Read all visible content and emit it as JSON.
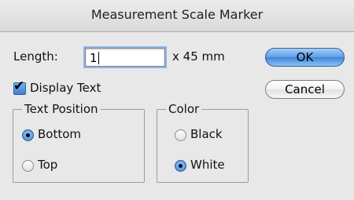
{
  "window": {
    "title": "Measurement Scale Marker"
  },
  "length": {
    "label": "Length:",
    "value": "1",
    "unit": "x 45 mm"
  },
  "display_text": {
    "label": "Display Text",
    "checked": true
  },
  "text_position": {
    "label": "Text Position",
    "options": [
      {
        "label": "Bottom",
        "selected": true
      },
      {
        "label": "Top",
        "selected": false
      }
    ]
  },
  "color": {
    "label": "Color",
    "options": [
      {
        "label": "Black",
        "selected": false
      },
      {
        "label": "White",
        "selected": true
      }
    ]
  },
  "buttons": {
    "ok": "OK",
    "cancel": "Cancel"
  },
  "icons": {
    "checkbox": "checkmark",
    "radio_selected": "radio-dot"
  },
  "colors": {
    "accent": "#3d86db",
    "dialog_bg": "#e8e8e8"
  }
}
